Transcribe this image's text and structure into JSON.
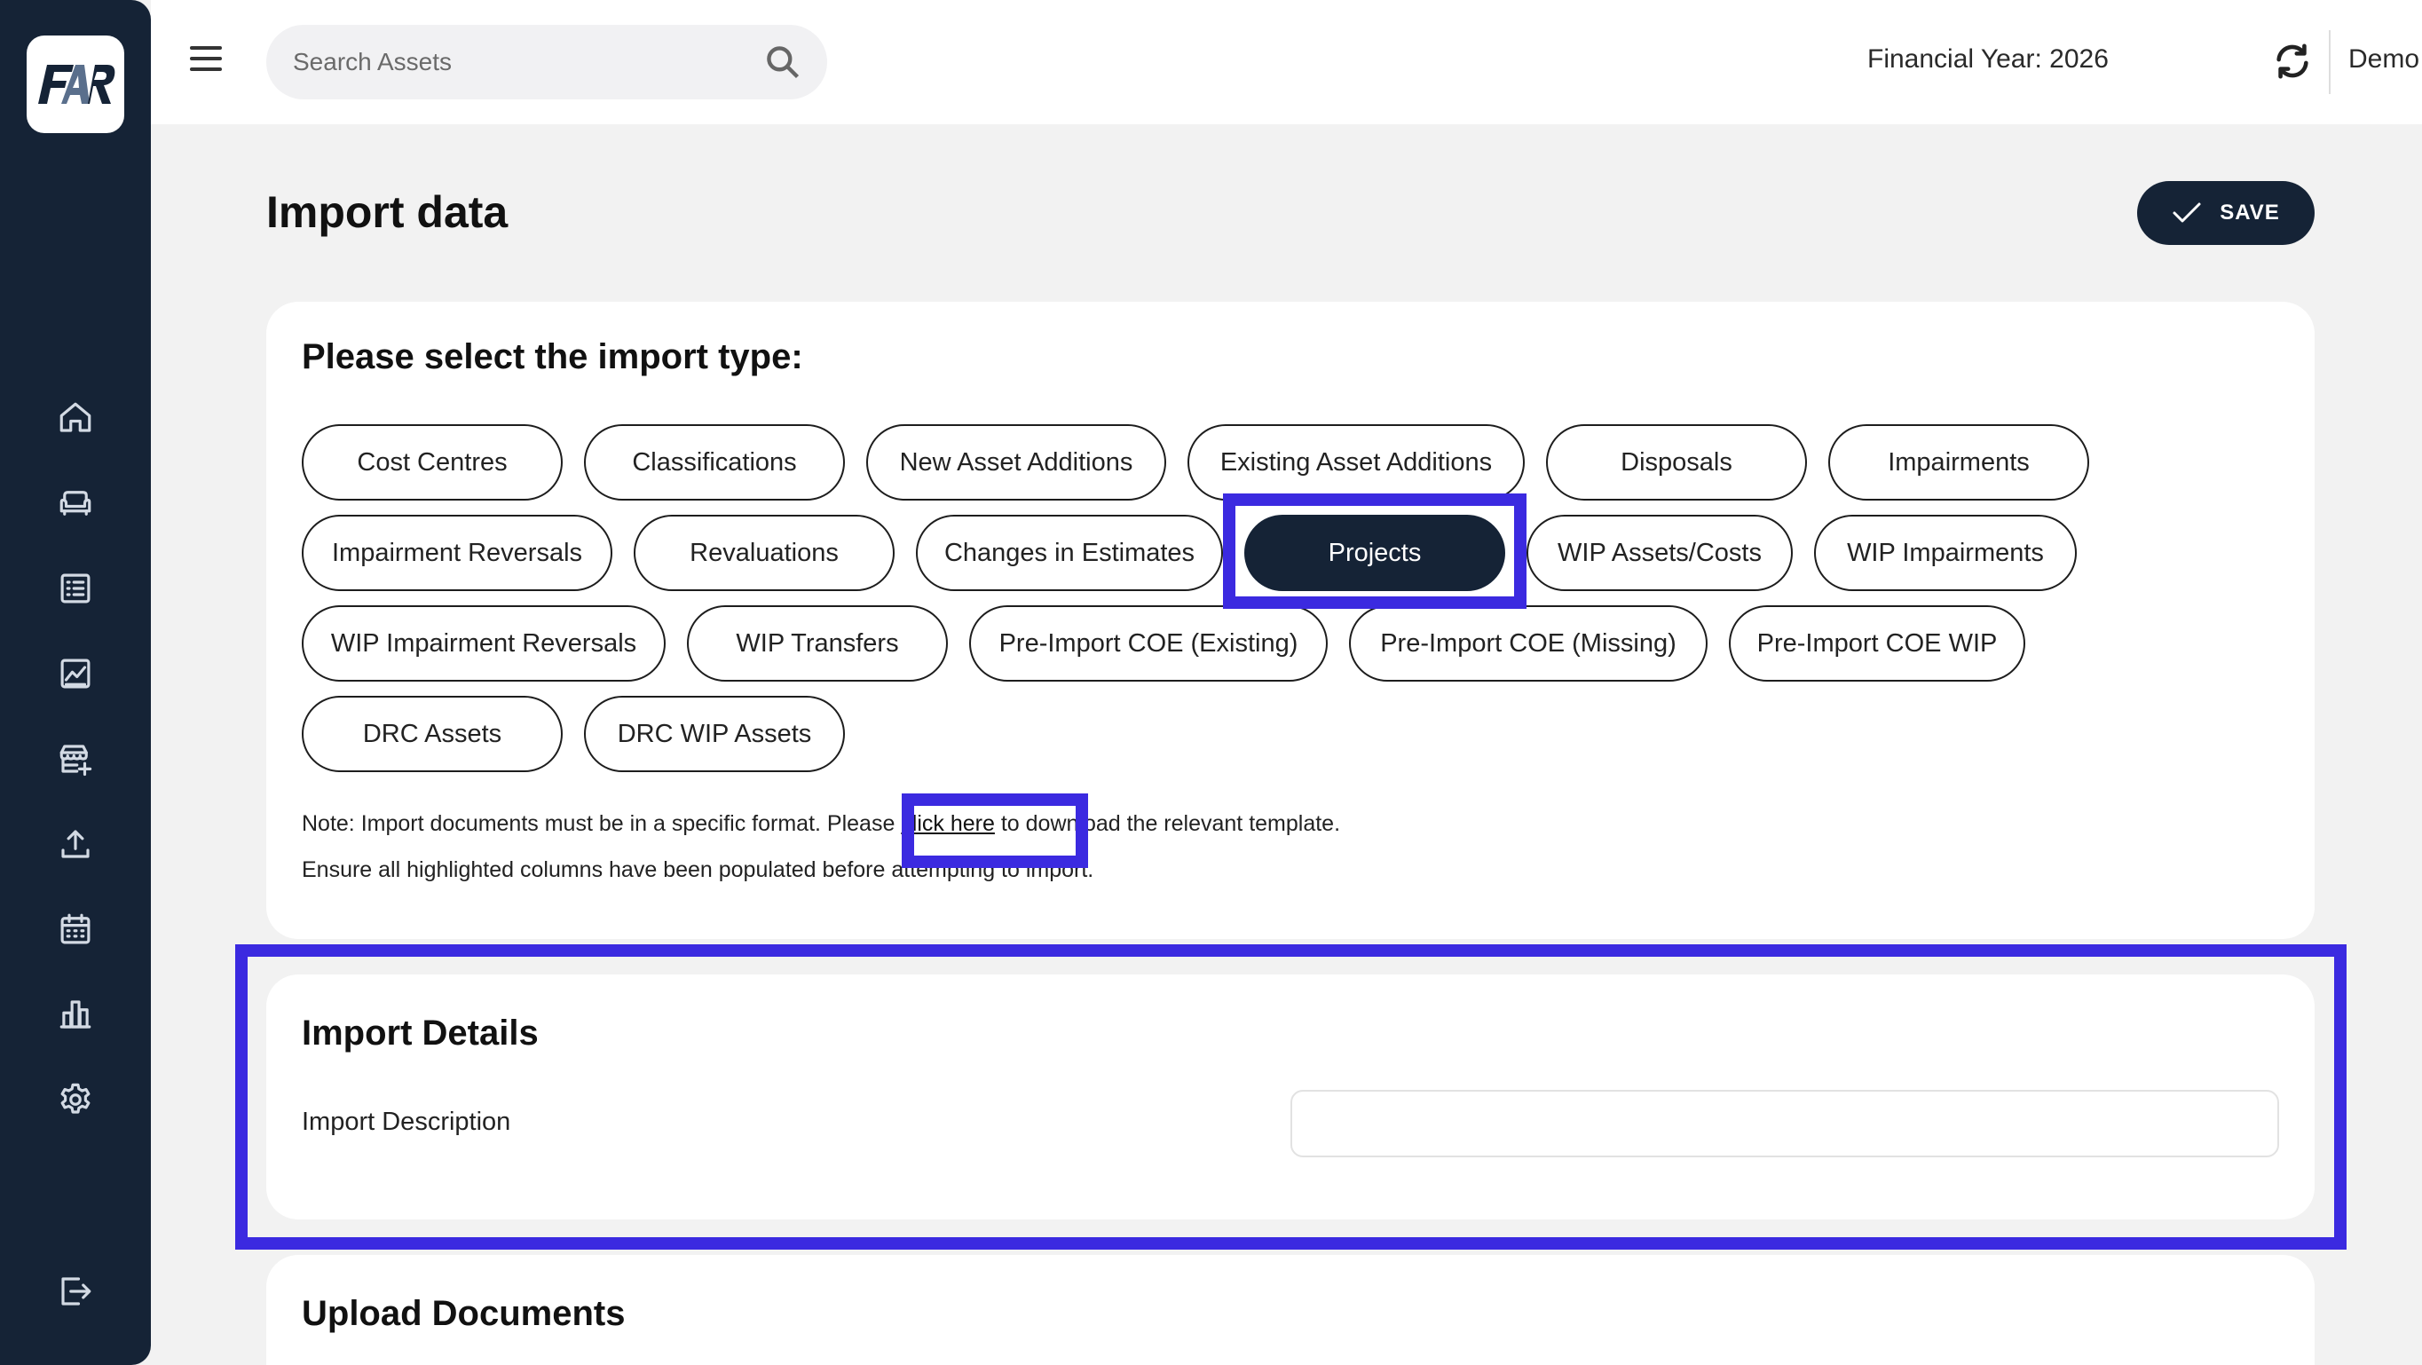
{
  "app": {
    "logo_text": "FAR"
  },
  "topbar": {
    "search_placeholder": "Search Assets",
    "financial_year": "Financial Year: 2026",
    "entity": "Demo Entity"
  },
  "page": {
    "title": "Import data",
    "save_label": "SAVE"
  },
  "import_type": {
    "heading": "Please select the import type:",
    "selected": "Projects",
    "options": [
      "Cost Centres",
      "Classifications",
      "New Asset Additions",
      "Existing Asset Additions",
      "Disposals",
      "Impairments",
      "Impairment Reversals",
      "Revaluations",
      "Changes in Estimates",
      "Projects",
      "WIP Assets/Costs",
      "WIP Impairments",
      "WIP Impairment Reversals",
      "WIP Transfers",
      "Pre-Import COE (Existing)",
      "Pre-Import COE (Missing)",
      "Pre-Import COE WIP",
      "DRC Assets",
      "DRC WIP Assets"
    ],
    "note_prefix": "Note: Import documents must be in a specific format. Please ",
    "note_link": "click here",
    "note_suffix": " to download the relevant template.",
    "note_line2": "Ensure all highlighted columns have been populated before attempting to import."
  },
  "import_details": {
    "heading": "Import Details",
    "description_label": "Import Description",
    "description_value": ""
  },
  "upload": {
    "heading": "Upload Documents"
  },
  "colors": {
    "sidebar": "#152336",
    "accent_dark": "#152336",
    "highlight": "#3b2ae0",
    "background": "#f2f2f2"
  },
  "sidebar_icons": [
    "home-icon",
    "sofa-icon",
    "list-icon",
    "chart-icon",
    "store-add-icon",
    "upload-icon",
    "calendar-icon",
    "bar-chart-icon",
    "gear-icon",
    "logout-icon"
  ]
}
